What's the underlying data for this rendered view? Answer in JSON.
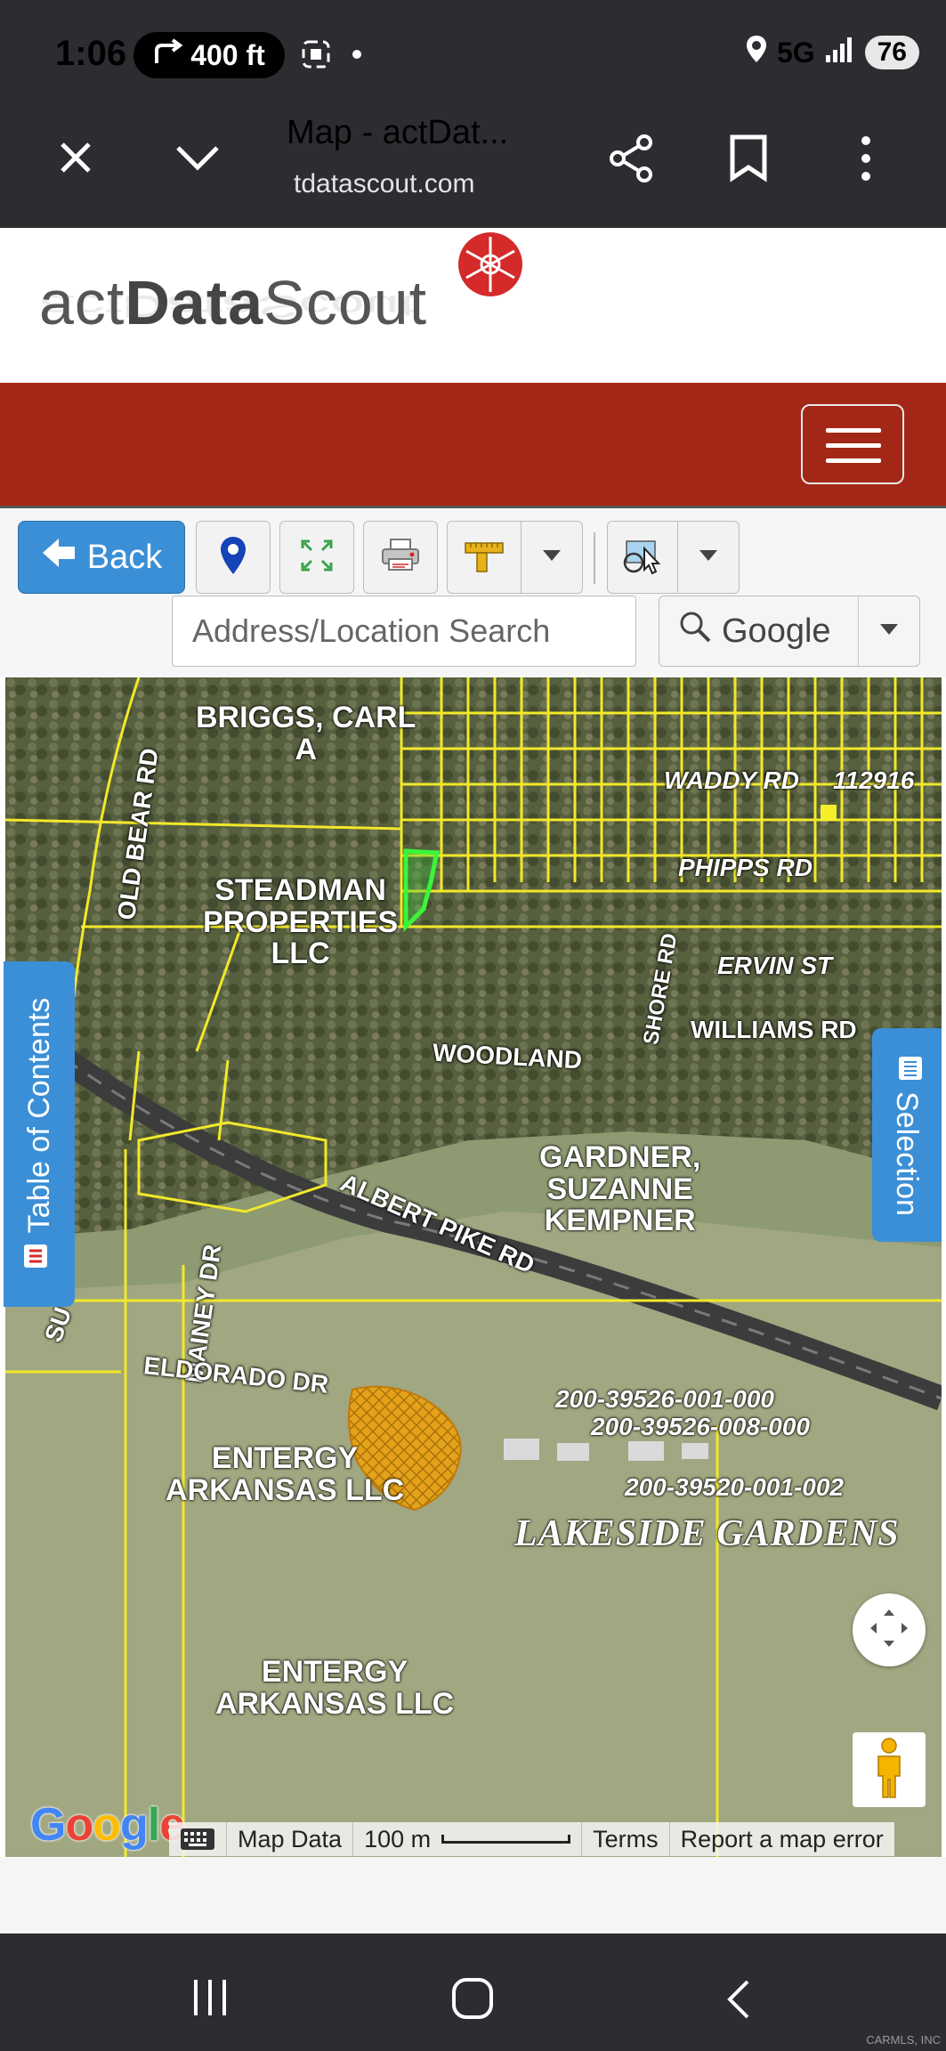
{
  "status_bar": {
    "time": "1:06",
    "nav_distance": "400 ft",
    "network": "5G",
    "battery": "76",
    "icons": [
      "turn-right-icon",
      "screenshot-icon",
      "dot-icon",
      "location-icon",
      "signal-icon"
    ]
  },
  "browser": {
    "title": "Map - actDat...",
    "url": "tdatascout.com",
    "icons": [
      "close-icon",
      "chevron-down-icon",
      "share-icon",
      "bookmark-icon",
      "more-vert-icon"
    ]
  },
  "header": {
    "logo_part1": "act",
    "logo_part2": "Data",
    "logo_part3": "Scout",
    "brand_color": "#a32716"
  },
  "toolbar": {
    "back_label": "Back",
    "search_placeholder": "Address/Location Search",
    "search_provider": "Google",
    "accent_color": "#3b8fd6"
  },
  "map": {
    "parcel_owners": [
      {
        "label": "BRIGGS, CARL\nA"
      },
      {
        "label": "STEADMAN\nPROPERTIES\nLLC"
      },
      {
        "label": "GARDNER,\nSUZANNE\nKEMPNER"
      },
      {
        "label": "ENTERGY\nARKANSAS LLC"
      },
      {
        "label": "ENTERGY\nARKANSAS LLC"
      }
    ],
    "roads": [
      "OLD BEAR RD",
      "WADDY RD",
      "PHIPPS RD",
      "ERVIN ST",
      "WILLIAMS RD",
      "WOODLAND",
      "SHORE RD",
      "ALBERT PIKE RD",
      "MAINEY DR",
      "ELDORADO DR",
      "SU"
    ],
    "parcel_ids": [
      "112916",
      "200-39526-001-000",
      "200-39526-008-000",
      "200-39520-001-002"
    ],
    "subdivision": "LAKESIDE GARDENS",
    "toc_label": "Table of Contents",
    "selection_label": "Selection",
    "google_logo": "Google",
    "attribution": {
      "map_data": "Map Data",
      "scale": "100 m",
      "terms": "Terms",
      "report": "Report a map error"
    }
  },
  "watermark": "CARMLS, INC"
}
